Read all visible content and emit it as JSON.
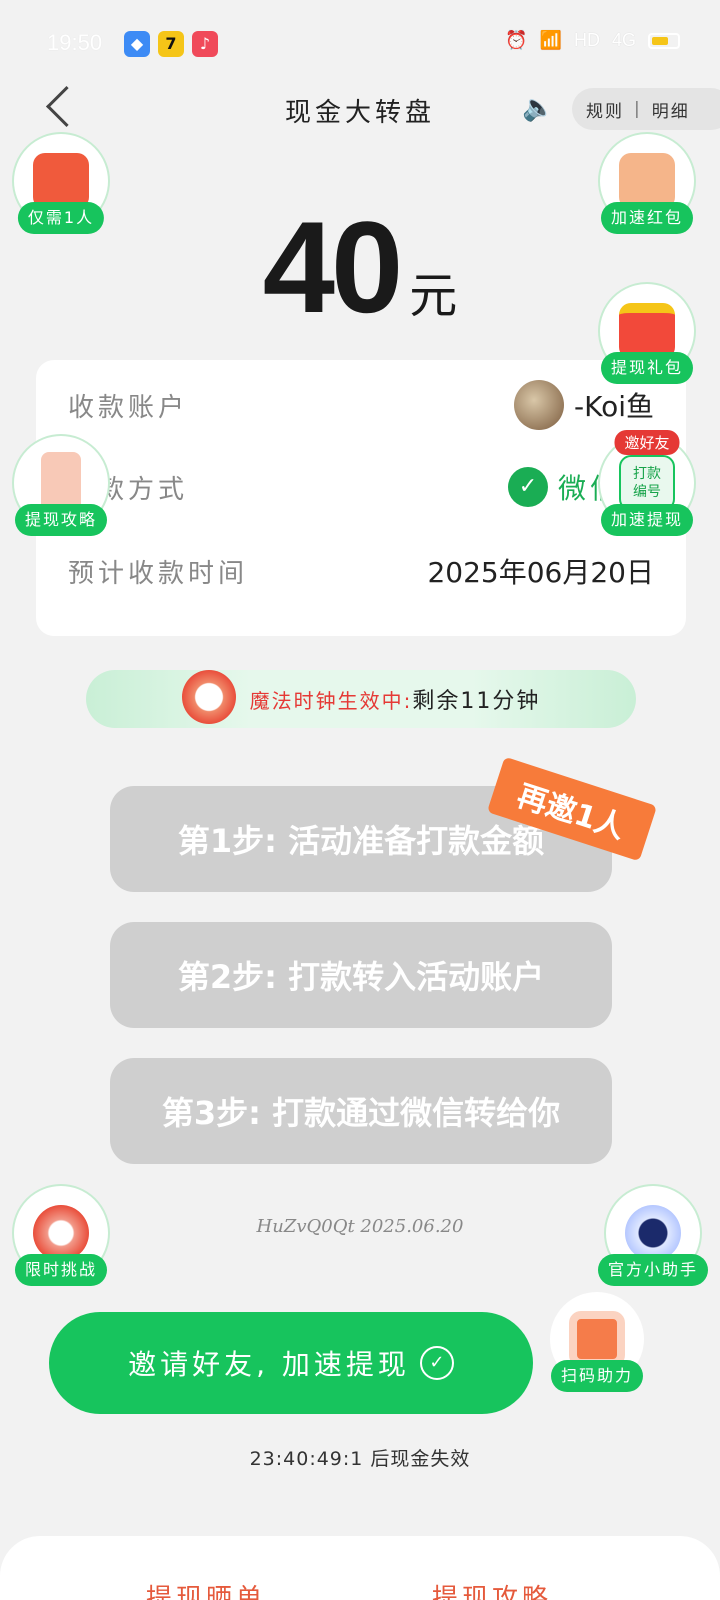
{
  "statusbar": {
    "time": "19:50",
    "network": "HD",
    "signal": "4G"
  },
  "nav": {
    "title": "现金大转盘",
    "rules": "规则",
    "details": "明细"
  },
  "amount": {
    "value": "40",
    "unit": "元"
  },
  "card": {
    "account_label": "收款账户",
    "account_value": "-Koi鱼",
    "method_label": "收款方式",
    "method_value": "微信打",
    "time_label": "预计收款时间",
    "time_value": "2025年06月20日"
  },
  "banner": {
    "effect": "魔法时钟生效中:",
    "remaining": "剩余11分钟"
  },
  "tag": "再邀1人",
  "steps": [
    "第1步: 活动准备打款金额",
    "第2步: 打款转入活动账户",
    "第3步: 打款通过微信转给你"
  ],
  "code": "HuZvQ0Qt 2025.06.20",
  "main_button": "邀请好友, 加速提现",
  "countdown": "23:40:49:1 后现金失效",
  "floats": {
    "only_one": "仅需1人",
    "speed_redpacket": "加速红包",
    "gift": "提现礼包",
    "guide": "提现攻略",
    "invite_tag": "邀好友",
    "pay_code": "打款\n编号",
    "speed_withdraw": "加速提现",
    "challenge": "限时挑战",
    "assistant": "官方小助手",
    "scan": "扫码助力"
  },
  "bottom_tabs": [
    "提现晒单",
    "提现攻略"
  ]
}
